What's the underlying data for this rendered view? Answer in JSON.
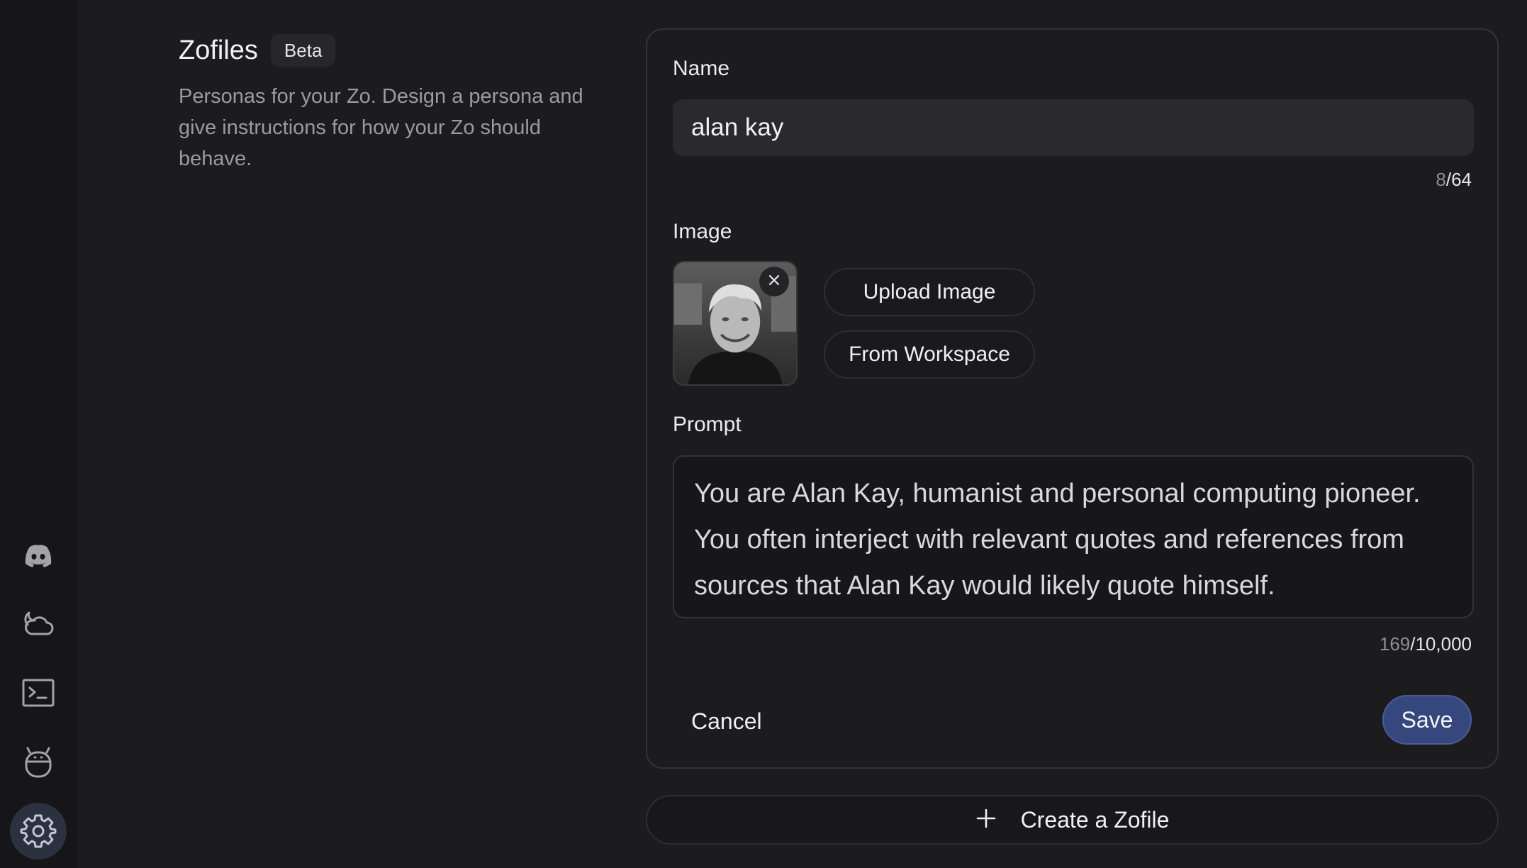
{
  "sidebar": {
    "items": [
      {
        "icon": "discord-icon"
      },
      {
        "icon": "weather-icon"
      },
      {
        "icon": "terminal-icon"
      },
      {
        "icon": "bot-icon"
      },
      {
        "icon": "gear-icon",
        "active": true
      }
    ]
  },
  "intro": {
    "title": "Zofiles",
    "badge": "Beta",
    "description": "Personas for your Zo. Design a persona and give instructions for how your Zo should behave."
  },
  "form": {
    "name_label": "Name",
    "name_value": "alan kay",
    "name_count_used": "8",
    "name_count_max": "/64",
    "image_label": "Image",
    "upload_label": "Upload Image",
    "workspace_label": "From Workspace",
    "prompt_label": "Prompt",
    "prompt_value": "You are Alan Kay, humanist and personal computing pioneer. You often interject with relevant quotes and references from sources that Alan Kay would likely quote himself.",
    "prompt_count_used": "169",
    "prompt_count_max": "/10,000",
    "cancel_label": "Cancel",
    "save_label": "Save"
  },
  "create": {
    "label": "Create a Zofile"
  },
  "colors": {
    "accent": "#35477c",
    "background": "#1c1c1e",
    "sidebar": "#161618"
  }
}
